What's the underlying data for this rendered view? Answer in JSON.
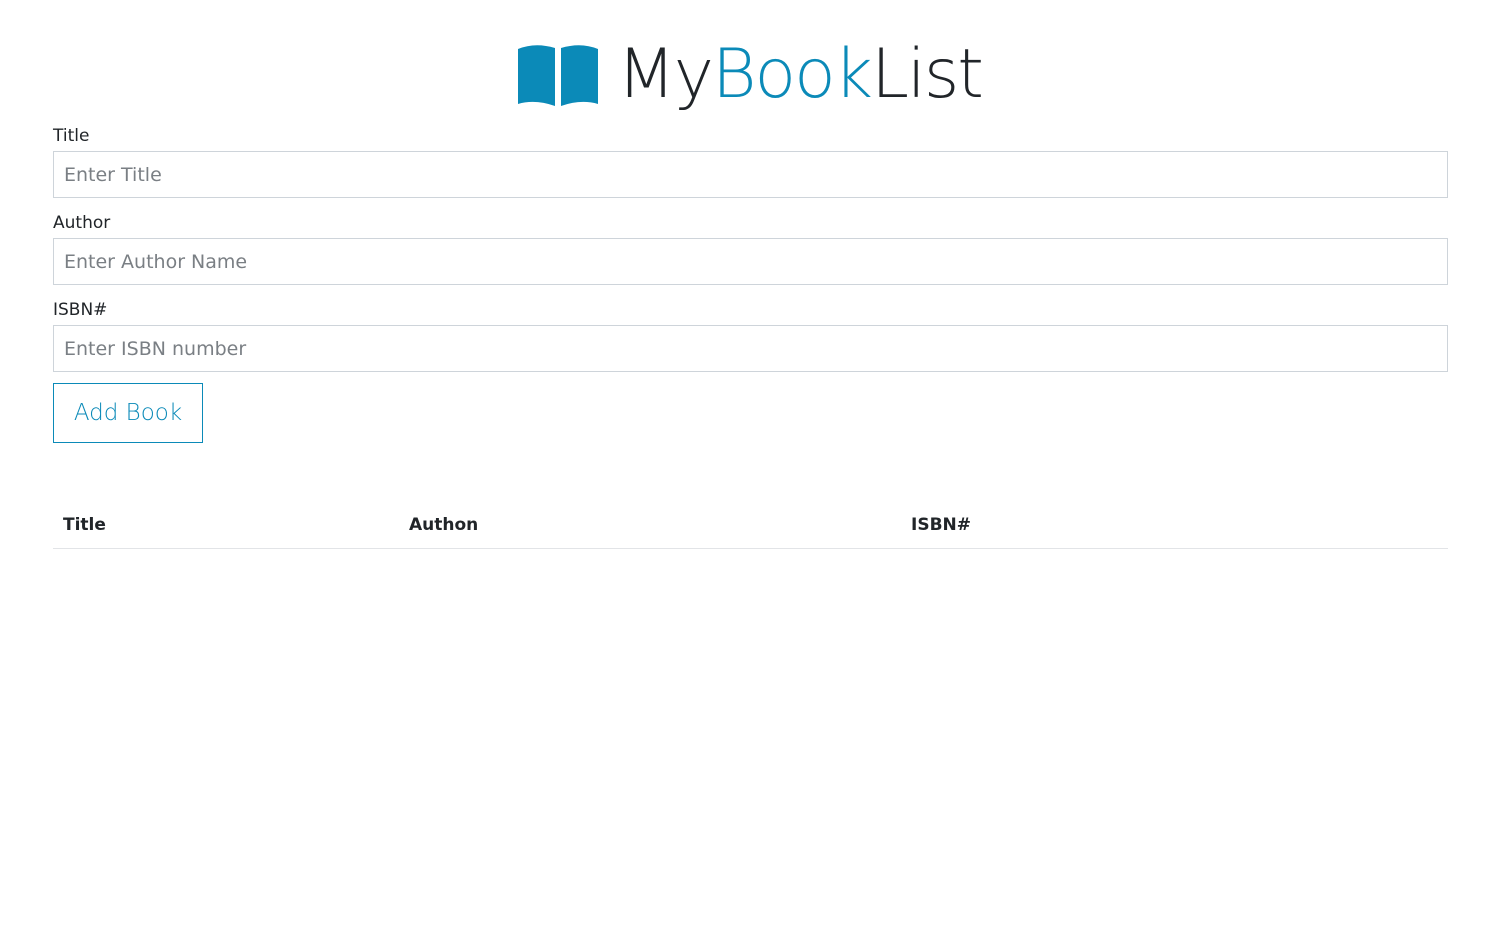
{
  "app": {
    "brand_part1": "My",
    "brand_part2": "Book",
    "brand_part3": "List",
    "logo_icon": "open-book-icon",
    "accent_color": "#0b8ab8"
  },
  "form": {
    "title_label": "Title",
    "title_placeholder": "Enter Title",
    "title_value": "",
    "author_label": "Author",
    "author_placeholder": "Enter Author Name",
    "author_value": "",
    "isbn_label": "ISBN#",
    "isbn_placeholder": "Enter ISBN number",
    "isbn_value": "",
    "submit_label": "Add Book"
  },
  "table": {
    "columns": [
      "Title",
      "Authon",
      "ISBN#"
    ],
    "rows": []
  }
}
